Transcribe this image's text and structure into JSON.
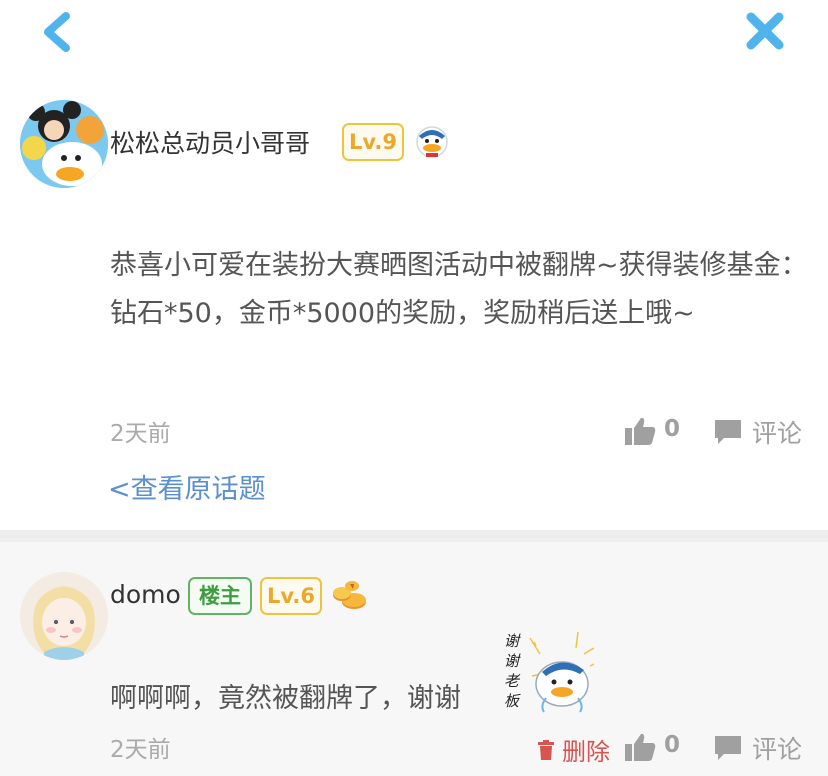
{
  "nav": {
    "back": "back-icon",
    "close": "close-icon"
  },
  "post": {
    "username": "松松总动员小哥哥",
    "level": "Lv.9",
    "text": "恭喜小可爱在装扮大赛晒图活动中被翻牌~获得装修基金：钻石*50，金币*5000的奖励，奖励稍后送上哦~",
    "time": "2天前",
    "likes": "0",
    "comment_label": "评论",
    "view_topic": "<查看原话题"
  },
  "reply": {
    "username": "domo",
    "host_badge": "楼主",
    "level": "Lv.6",
    "text": "啊啊啊，竟然被翻牌了，谢谢",
    "sticker_text": "谢谢老板",
    "time": "2天前",
    "delete_label": "删除",
    "likes": "0",
    "comment_label": "评论"
  },
  "colors": {
    "accent_blue": "#5a8fd2",
    "nav_blue": "#4fb3ec",
    "level_gold": "#eaa928",
    "host_green": "#3e9d40",
    "delete_red": "#d9534f"
  }
}
